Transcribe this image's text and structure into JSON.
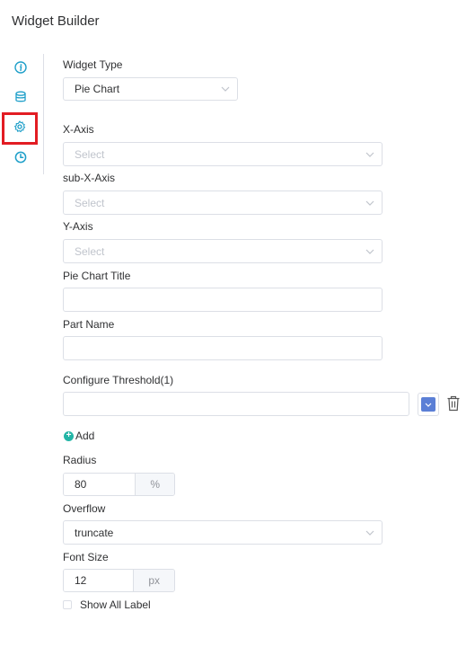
{
  "header": {
    "title": "Widget Builder"
  },
  "sidebar": {
    "items": [
      {
        "name": "info-icon"
      },
      {
        "name": "database-icon"
      },
      {
        "name": "gear-icon",
        "active": true
      },
      {
        "name": "clock-icon"
      }
    ],
    "accent_color": "#1e9fc9",
    "active_border_color": "#e21c23"
  },
  "form": {
    "widget_type": {
      "label": "Widget Type",
      "value": "Pie Chart"
    },
    "x_axis": {
      "label": "X-Axis",
      "placeholder": "Select"
    },
    "sub_x_axis": {
      "label": "sub-X-Axis",
      "placeholder": "Select"
    },
    "y_axis": {
      "label": "Y-Axis",
      "placeholder": "Select"
    },
    "pie_chart_title": {
      "label": "Pie Chart Title",
      "value": ""
    },
    "part_name": {
      "label": "Part Name",
      "value": ""
    },
    "threshold": {
      "label": "Configure Threshold(1)",
      "value": "",
      "color": "#5b7fd6"
    },
    "add_label": "Add",
    "radius": {
      "label": "Radius",
      "value": "80",
      "unit": "%"
    },
    "overflow": {
      "label": "Overflow",
      "value": "truncate"
    },
    "font_size": {
      "label": "Font Size",
      "value": "12",
      "unit": "px"
    },
    "show_all_label": {
      "label": "Show All Label",
      "checked": false
    }
  }
}
